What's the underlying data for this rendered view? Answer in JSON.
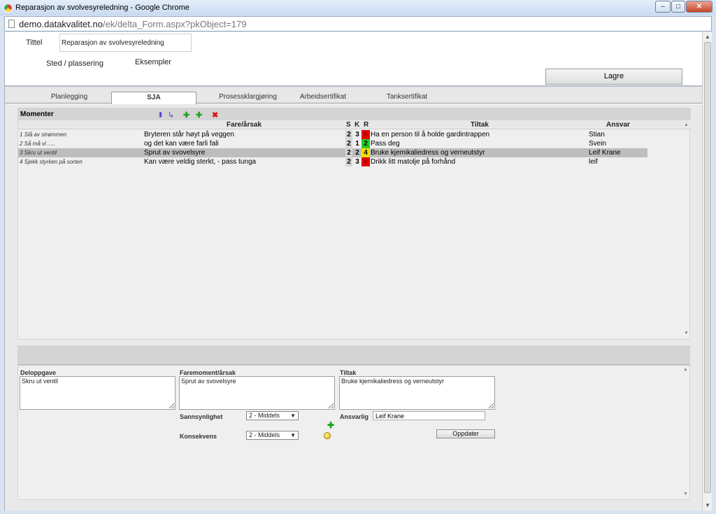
{
  "window": {
    "title": "Reparasjon av svolvesyreledning - Google Chrome",
    "btn_min": "–",
    "btn_max": "□",
    "btn_close": "✕"
  },
  "url": {
    "host": "demo.datakvalitet.no",
    "path": "/ek/delta_Form.aspx?pkObject=179"
  },
  "header": {
    "title_label": "Tittel",
    "title_value": "Reparasjon av svolvesyreledning",
    "location_label": "Sted / plassering",
    "location_value": "Eksempler",
    "save_label": "Lagre"
  },
  "tabs": [
    {
      "label": "Planlegging"
    },
    {
      "label": "SJA"
    },
    {
      "label": "Prosessklargjøring"
    },
    {
      "label": "Arbeidsertifikat"
    },
    {
      "label": "Tanksertifikat"
    }
  ],
  "active_tab": "SJA",
  "grid": {
    "title": "Momenter",
    "icons": [
      "sort-icon",
      "sort-child-icon",
      "add-icon",
      "add-child-icon",
      "delete-icon"
    ],
    "columns": {
      "fare": "Fare/årsak",
      "s": "S",
      "k": "K",
      "r": "R",
      "tiltak": "Tiltak",
      "ansvar": "Ansvar"
    },
    "rows": [
      {
        "moment": "1 Slå av strømmen",
        "fare": "Bryteren står høyt på veggen",
        "s": "2",
        "k": "3",
        "r": "6",
        "r_color": "#e60000",
        "tiltak": "Ha en person til å holde gardintrappen",
        "ansvar": "Stian",
        "selected": false
      },
      {
        "moment": "2 Så må vi .....",
        "fare": "og det kan være farli fali",
        "s": "2",
        "k": "1",
        "r": "2",
        "r_color": "#22cc22",
        "tiltak": "Pass deg",
        "ansvar": "Svein",
        "selected": false
      },
      {
        "moment": "3 Skru ut ventil",
        "fare": "Sprut av svovelsyre",
        "s": "2",
        "k": "2",
        "r": "4",
        "r_color": "#f0e000",
        "tiltak": "Bruke kjemikaliedress og verneutstyr",
        "ansvar": "Leif Krane",
        "selected": true
      },
      {
        "moment": "4 Sjekk styrken på sorten",
        "fare": "Kan være veldig sterkt, - pass tunga",
        "s": "2",
        "k": "3",
        "r": "6",
        "r_color": "#e60000",
        "tiltak": "Drikk litt matolje på forhånd",
        "ansvar": "leif",
        "selected": false
      }
    ]
  },
  "detail": {
    "deloppgave_label": "Deloppgave",
    "deloppgave_value": "Skru ut ventil",
    "faremoment_label": "Faremoment/årsak",
    "faremoment_value": "Sprut av svovelsyre",
    "tiltak_label": "Tiltak",
    "tiltak_value": "Bruke kjemikaliedress og verneutstyr",
    "sannsynlighet_label": "Sannsynlighet",
    "sannsynlighet_value": "2 - Middels",
    "konsekvens_label": "Konsekvens",
    "konsekvens_value": "2 - Middels",
    "ansvarlig_label": "Ansvarlig",
    "ansvarlig_value": "Leif Krane",
    "update_label": "Oppdater"
  }
}
